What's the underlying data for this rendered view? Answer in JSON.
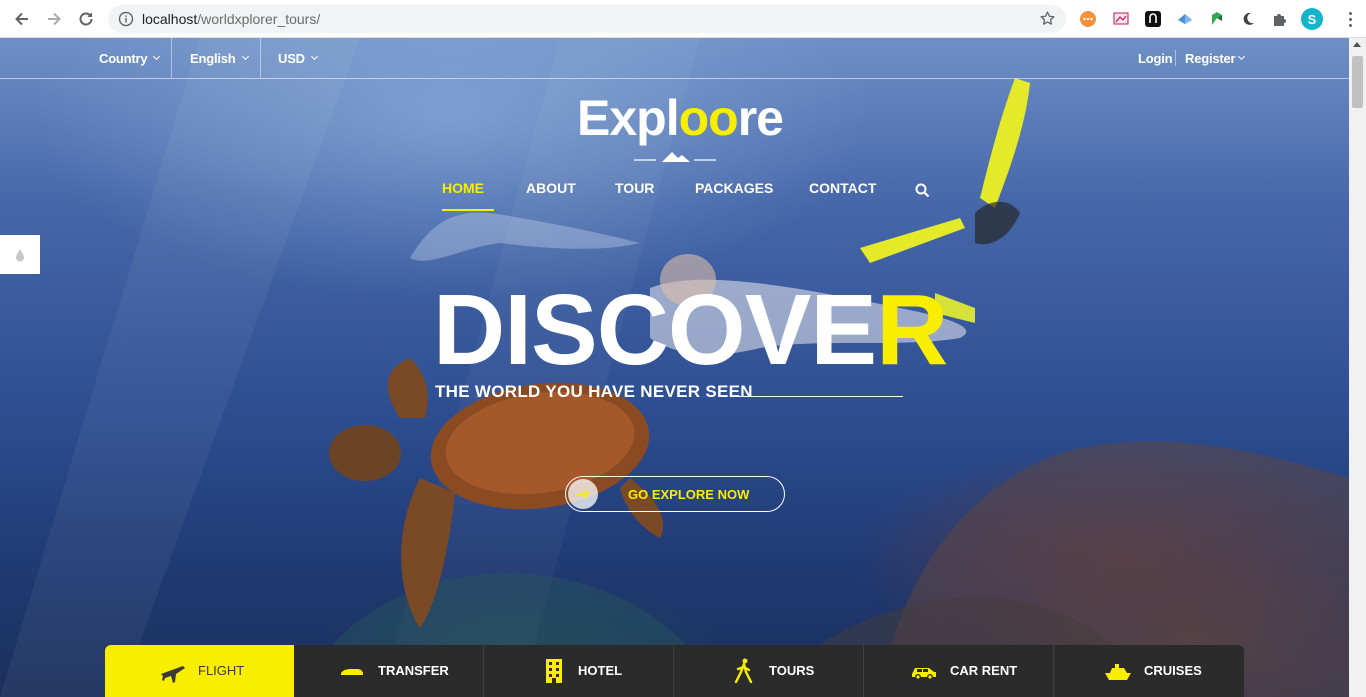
{
  "browser": {
    "url_host": "localhost",
    "url_path": "/worldxplorer_tours/",
    "profile_initial": "S"
  },
  "topbar": {
    "country_label": "Country",
    "language_label": "English",
    "currency_label": "USD",
    "login_label": "Login",
    "register_label": "Register"
  },
  "logo": {
    "part1": "Expl",
    "part2": "oo",
    "part3": "re"
  },
  "nav": {
    "items": [
      {
        "label": "HOME",
        "active": true
      },
      {
        "label": "ABOUT"
      },
      {
        "label": "TOUR"
      },
      {
        "label": "PACKAGES"
      },
      {
        "label": "CONTACT"
      }
    ]
  },
  "hero": {
    "headline_main": "DISCOVE",
    "headline_accent": "R",
    "tagline": "THE WORLD YOU HAVE NEVER SEEN",
    "cta_label": "GO EXPLORE NOW"
  },
  "search_tabs": [
    {
      "label": "FLIGHT",
      "icon": "plane-icon",
      "active": true
    },
    {
      "label": "TRANSFER",
      "icon": "car-transfer-icon"
    },
    {
      "label": "HOTEL",
      "icon": "hotel-building-icon"
    },
    {
      "label": "TOURS",
      "icon": "hiker-icon"
    },
    {
      "label": "CAR RENT",
      "icon": "car-icon"
    },
    {
      "label": "CRUISES",
      "icon": "cruise-ship-icon"
    }
  ],
  "colors": {
    "accent": "#f9ed00",
    "tab_bar": "#2b2b2b"
  }
}
